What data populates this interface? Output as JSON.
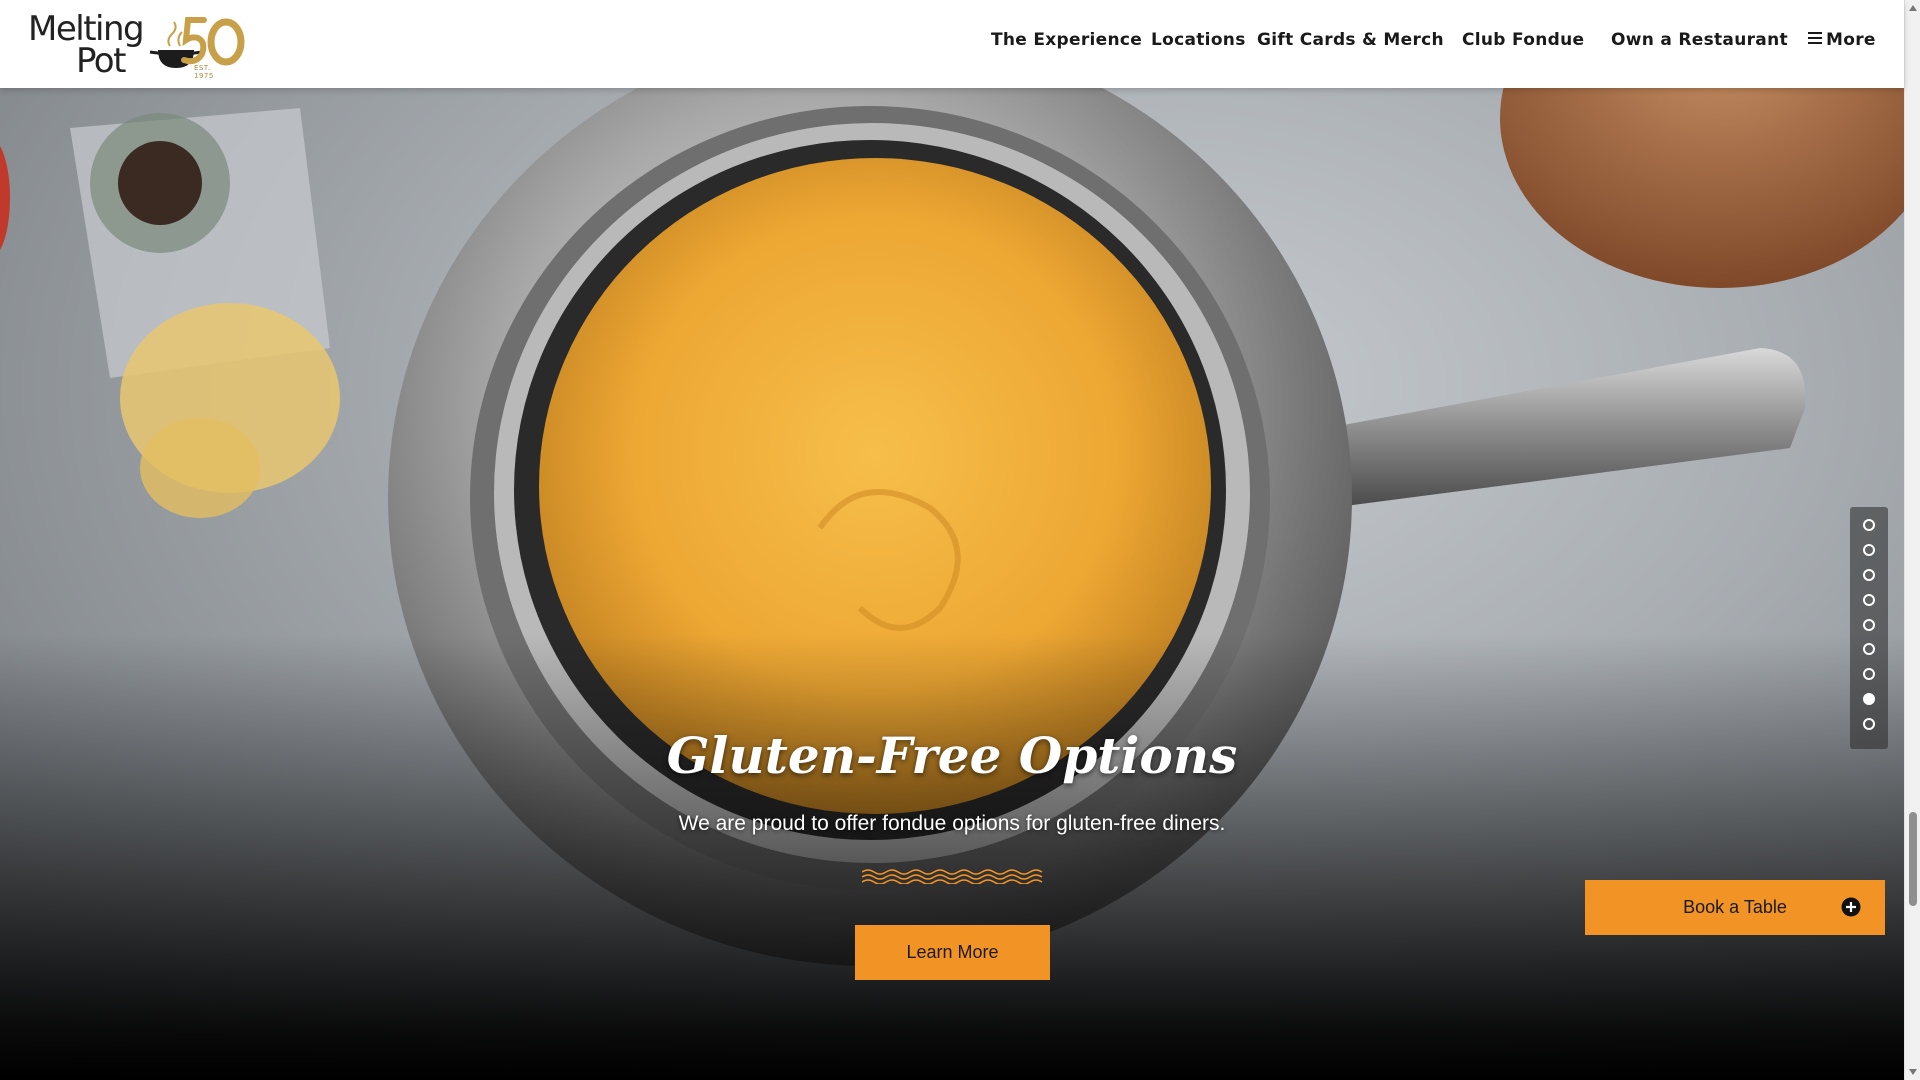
{
  "brand": {
    "logo_line1": "Melting",
    "logo_line2": "Pot",
    "anniversary": "50",
    "est": "EST. 1975"
  },
  "nav": {
    "items": [
      {
        "label": "The Experience"
      },
      {
        "label": "Locations"
      },
      {
        "label": "Gift Cards & Merch"
      },
      {
        "label": "Club Fondue"
      },
      {
        "label": "Own a Restaurant"
      },
      {
        "label": "More"
      }
    ]
  },
  "hero": {
    "title": "Gluten-Free Options",
    "text": "We are proud to offer fondue options for gluten-free diners.",
    "cta_label": "Learn More",
    "slide_count": 9,
    "active_slide": 8
  },
  "book_button": {
    "label": "Book a Table"
  },
  "colors": {
    "accent": "#f29425",
    "header_bg": "#ffffff",
    "logo_gold": "#c9a04a"
  }
}
